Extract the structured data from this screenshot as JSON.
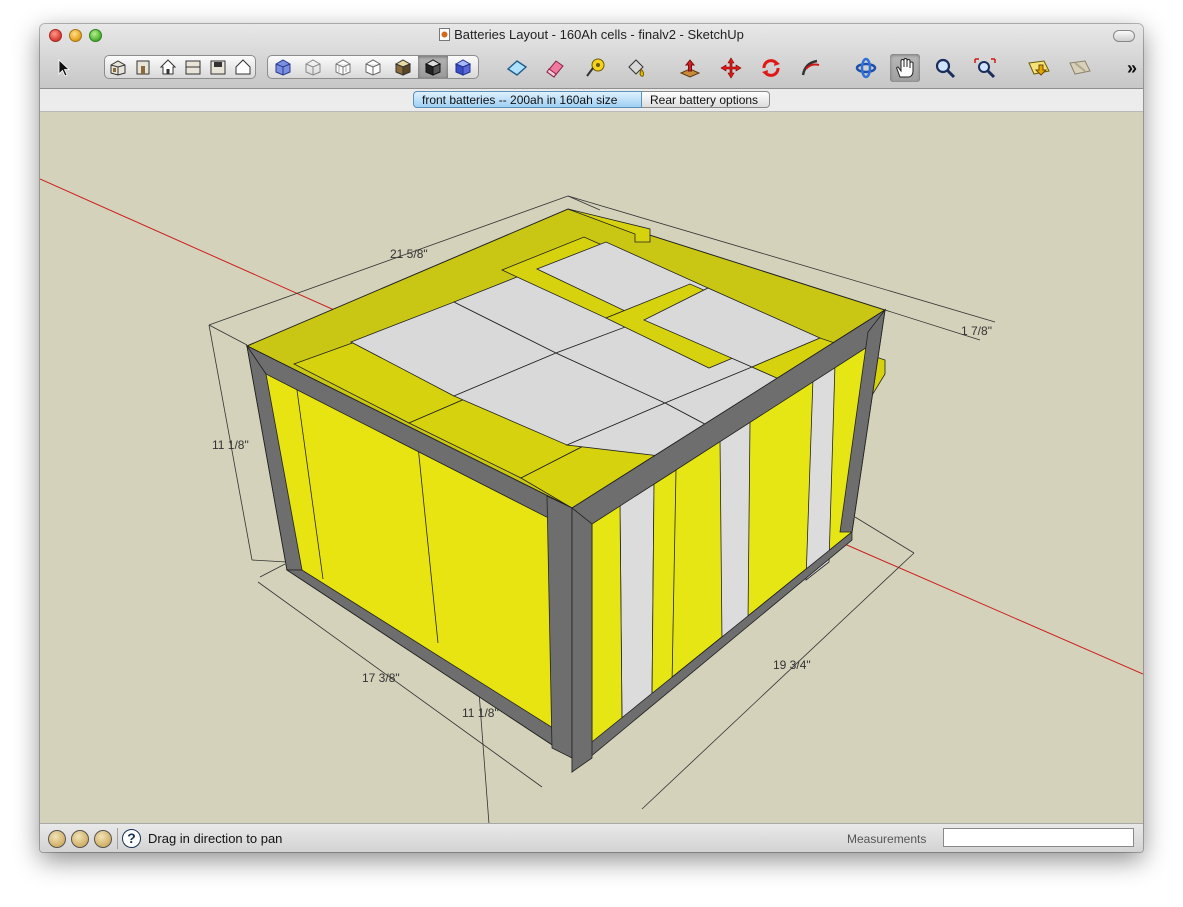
{
  "window": {
    "title": "Batteries Layout - 160Ah cells - finalv2 - SketchUp"
  },
  "toolbar": {
    "select_tool": "arrow-select-icon",
    "views": [
      "iso-view-icon",
      "front-view-icon",
      "home-view-icon",
      "top-view-icon",
      "right-view-icon",
      "back-view-icon"
    ],
    "styles": [
      "xray-style-icon",
      "wireframe-style-icon",
      "hidden-line-style-icon",
      "shaded-style-icon",
      "shaded-texture-style-icon",
      "monochrome-style-icon",
      "edges-style-icon"
    ],
    "tools": [
      "rectangle-tool-icon",
      "eraser-tool-icon",
      "tape-measure-icon",
      "paint-bucket-icon",
      "push-pull-icon",
      "move-tool-icon",
      "rotate-tool-icon",
      "follow-me-icon",
      "orbit-icon",
      "pan-hand-icon",
      "zoom-icon",
      "zoom-extents-icon",
      "previous-view-icon",
      "next-view-icon"
    ],
    "overflow": "»"
  },
  "scenes": {
    "tabs": [
      {
        "label": "front batteries -- 200ah in 160ah size",
        "active": true
      },
      {
        "label": "Rear battery options",
        "active": false
      }
    ]
  },
  "model": {
    "dimensions": {
      "top_width": "21 5/8\"",
      "right_offset": "1 7/8\"",
      "left_height": "11 1/8\"",
      "front_width": "17 3/8\"",
      "front_height": "11 1/8\"",
      "side_depth": "19 3/4\""
    },
    "colors": {
      "yellow": "#e6e614",
      "yellow_top": "#d6d20e",
      "white_cell": "#dcdcdc",
      "frame": "#6e6e6e",
      "axis_red": "#cc1f1f",
      "background": "#d4d2bb"
    }
  },
  "statusbar": {
    "icons": [
      "geo-location-icon",
      "credits-icon",
      "user-icon",
      "help-icon"
    ],
    "help_glyph": "?",
    "status_text": "Drag in direction to pan",
    "measurements_label": "Measurements",
    "measurements_value": ""
  }
}
